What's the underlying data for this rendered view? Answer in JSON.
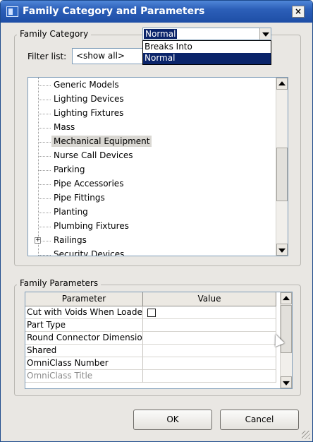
{
  "window": {
    "title": "Family Category and Parameters",
    "close_glyph": "×"
  },
  "family_category": {
    "legend": "Family Category",
    "filter_label": "Filter list:",
    "filter_value": "<show all>",
    "items": [
      {
        "label": "Generic Models",
        "selected": false
      },
      {
        "label": "Lighting Devices",
        "selected": false
      },
      {
        "label": "Lighting Fixtures",
        "selected": false
      },
      {
        "label": "Mass",
        "selected": false
      },
      {
        "label": "Mechanical Equipment",
        "selected": true
      },
      {
        "label": "Nurse Call Devices",
        "selected": false
      },
      {
        "label": "Parking",
        "selected": false
      },
      {
        "label": "Pipe Accessories",
        "selected": false
      },
      {
        "label": "Pipe Fittings",
        "selected": false
      },
      {
        "label": "Planting",
        "selected": false
      },
      {
        "label": "Plumbing Fixtures",
        "selected": false
      },
      {
        "label": "Railings",
        "selected": false,
        "expandable": true
      },
      {
        "label": "Security Devices",
        "selected": false
      }
    ]
  },
  "family_parameters": {
    "legend": "Family Parameters",
    "columns": [
      "Parameter",
      "Value"
    ],
    "rows": [
      {
        "parameter": "Cut with Voids When Loaded",
        "value": "",
        "type": "checkbox",
        "checked": false
      },
      {
        "parameter": "Part Type",
        "value": "Normal",
        "type": "select"
      },
      {
        "parameter": "Round Connector Dimension",
        "value": "",
        "type": "text"
      },
      {
        "parameter": "Shared",
        "value": "",
        "type": "text"
      },
      {
        "parameter": "OmniClass Number",
        "value": "",
        "type": "text"
      },
      {
        "parameter": "OmniClass Title",
        "value": "",
        "type": "text",
        "disabled": true
      }
    ],
    "dropdown_options": [
      {
        "label": "Breaks Into",
        "highlighted": false
      },
      {
        "label": "Normal",
        "highlighted": true
      }
    ]
  },
  "buttons": {
    "ok": "OK",
    "cancel": "Cancel"
  },
  "colors": {
    "titlebar": "#2c5fb8",
    "selection": "#0a246a",
    "dialog_bg": "#e9e7e3"
  }
}
